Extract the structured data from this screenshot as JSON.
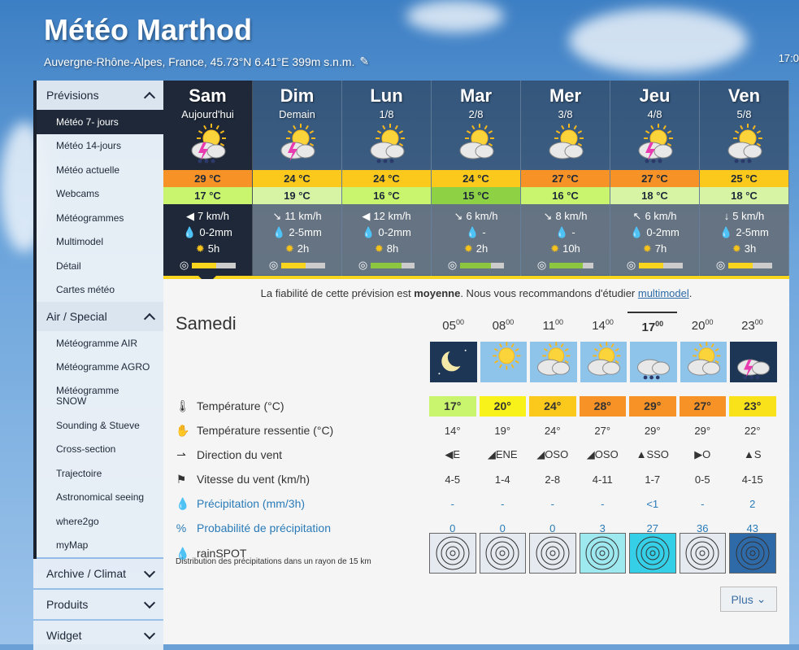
{
  "header": {
    "title": "Météo Marthod",
    "subtitle": "Auvergne-Rhône-Alpes, France, 45.73°N 6.41°E 399m s.n.m.",
    "time": "17:0"
  },
  "sidebar": {
    "sections": [
      {
        "label": "Prévisions",
        "open": true,
        "items": [
          "Météo 7- jours",
          "Météo 14-jours",
          "Météo actuelle",
          "Webcams",
          "Météogrammes",
          "Multimodel",
          "Détail",
          "Cartes météo"
        ]
      },
      {
        "label": "Air / Special",
        "open": true,
        "items": [
          "Météogramme AIR",
          "Météogramme AGRO",
          "Météogramme SNOW",
          "Sounding & Stueve",
          "Cross-section",
          "Trajectoire",
          "Astronomical seeing",
          "where2go",
          "myMap"
        ]
      },
      {
        "label": "Archive / Climat",
        "open": false,
        "items": []
      },
      {
        "label": "Produits",
        "open": false,
        "items": []
      },
      {
        "label": "Widget",
        "open": false,
        "items": []
      }
    ]
  },
  "days": [
    {
      "name": "Sam",
      "date": "Aujourd'hui",
      "icon": "thunder-sun-rain",
      "tmax": "29 °C",
      "tmin": "17 °C",
      "tmax_color": "#f79226",
      "tmin_color": "#c9f46e",
      "wind_dir": "◀",
      "wind": "7 km/h",
      "precip": "0-2mm",
      "sun": "5h",
      "reliability": 0.55
    },
    {
      "name": "Dim",
      "date": "Demain",
      "icon": "thunder-sun",
      "tmax": "24 °C",
      "tmin": "19 °C",
      "tmax_color": "#fbc91b",
      "tmin_color": "#d6f4a4",
      "wind_dir": "↘",
      "wind": "11 km/h",
      "precip": "2-5mm",
      "sun": "2h",
      "reliability": 0.55
    },
    {
      "name": "Lun",
      "date": "1/8",
      "icon": "sun-cloud-rain",
      "tmax": "24 °C",
      "tmin": "16 °C",
      "tmax_color": "#fbc91b",
      "tmin_color": "#c9f46e",
      "wind_dir": "◀",
      "wind": "12 km/h",
      "precip": "0-2mm",
      "sun": "8h",
      "reliability": 0.7
    },
    {
      "name": "Mar",
      "date": "2/8",
      "icon": "sun-cloud",
      "tmax": "24 °C",
      "tmin": "15 °C",
      "tmax_color": "#fbc91b",
      "tmin_color": "#8ed145",
      "wind_dir": "↘",
      "wind": "6 km/h",
      "precip": "-",
      "sun": "2h",
      "reliability": 0.7
    },
    {
      "name": "Mer",
      "date": "3/8",
      "icon": "sun-cloud",
      "tmax": "27 °C",
      "tmin": "16 °C",
      "tmax_color": "#f79226",
      "tmin_color": "#c9f46e",
      "wind_dir": "↘",
      "wind": "8 km/h",
      "precip": "-",
      "sun": "10h",
      "reliability": 0.75
    },
    {
      "name": "Jeu",
      "date": "4/8",
      "icon": "thunder-sun-rain",
      "tmax": "27 °C",
      "tmin": "18 °C",
      "tmax_color": "#f79226",
      "tmin_color": "#d6f4a4",
      "wind_dir": "↖",
      "wind": "6 km/h",
      "precip": "0-2mm",
      "sun": "7h",
      "reliability": 0.55
    },
    {
      "name": "Ven",
      "date": "5/8",
      "icon": "sun-cloud-rain",
      "tmax": "25 °C",
      "tmin": "18 °C",
      "tmax_color": "#fbc91b",
      "tmin_color": "#d6f4a4",
      "wind_dir": "↓",
      "wind": "5 km/h",
      "precip": "2-5mm",
      "sun": "3h",
      "reliability": 0.55
    }
  ],
  "reliability_text": {
    "pre": "La fiabilité de cette prévision est ",
    "strong": "moyenne",
    "mid": ". Nous vous recommandons d'étudier ",
    "link": "multimodel",
    "post": "."
  },
  "detail": {
    "day_label": "Samedi",
    "hours": [
      {
        "h": "05",
        "m": "00"
      },
      {
        "h": "08",
        "m": "00"
      },
      {
        "h": "11",
        "m": "00"
      },
      {
        "h": "14",
        "m": "00"
      },
      {
        "h": "17",
        "m": "00"
      },
      {
        "h": "20",
        "m": "00"
      },
      {
        "h": "23",
        "m": "00"
      }
    ],
    "rows": {
      "temp": {
        "label": "Température (°C)",
        "values": [
          "17°",
          "20°",
          "24°",
          "28°",
          "29°",
          "27°",
          "23°"
        ],
        "colors": [
          "#c9f46e",
          "#f9f21a",
          "#fbc91b",
          "#f79226",
          "#f79226",
          "#f79226",
          "#f9e21a"
        ]
      },
      "felt": {
        "label": "Température ressentie (°C)",
        "values": [
          "14°",
          "19°",
          "24°",
          "27°",
          "29°",
          "29°",
          "22°"
        ]
      },
      "wdir": {
        "label": "Direction du vent",
        "values": [
          "◀E",
          "◢ENE",
          "◢OSO",
          "◢OSO",
          "▲SSO",
          "▶O",
          "▲S"
        ]
      },
      "wspd": {
        "label": "Vitesse du vent (km/h)",
        "values": [
          "4-5",
          "1-4",
          "2-8",
          "4-11",
          "1-7",
          "0-5",
          "4-15"
        ]
      },
      "precip": {
        "label": "Précipitation (mm/3h)",
        "values": [
          "-",
          "-",
          "-",
          "-",
          "<1",
          "-",
          "2"
        ]
      },
      "prob": {
        "label": "Probabilité de précipitation",
        "values": [
          "0",
          "0",
          "0",
          "3",
          "27",
          "36",
          "43"
        ]
      },
      "rain": {
        "label": "rainSPOT",
        "sub": "Distribution des précipitations dans un rayon de 15 km"
      }
    },
    "plus_label": "Plus"
  }
}
